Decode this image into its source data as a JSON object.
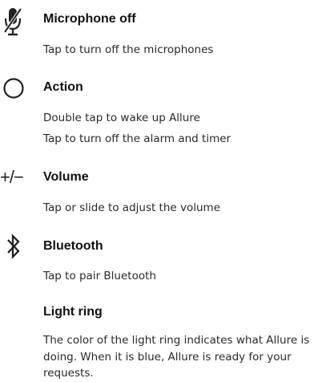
{
  "sections": [
    {
      "icon": "microphone-off-icon",
      "title": "Microphone off",
      "lines": [
        "Tap to turn off the microphones"
      ]
    },
    {
      "icon": "action-circle-icon",
      "title": "Action",
      "lines": [
        "Double tap to wake up Allure",
        "Tap to turn off the alarm and timer"
      ]
    },
    {
      "icon": "volume-plus-minus-icon",
      "icon_text": "+/−",
      "title": "Volume",
      "lines": [
        "Tap or slide to adjust the volume"
      ]
    },
    {
      "icon": "bluetooth-icon",
      "title": "Bluetooth",
      "lines": [
        "Tap to pair Bluetooth"
      ]
    },
    {
      "title": "Light ring",
      "paragraph": "The color of the light ring indicates what Allure is doing. When it is blue, Allure is ready for your requests."
    }
  ]
}
